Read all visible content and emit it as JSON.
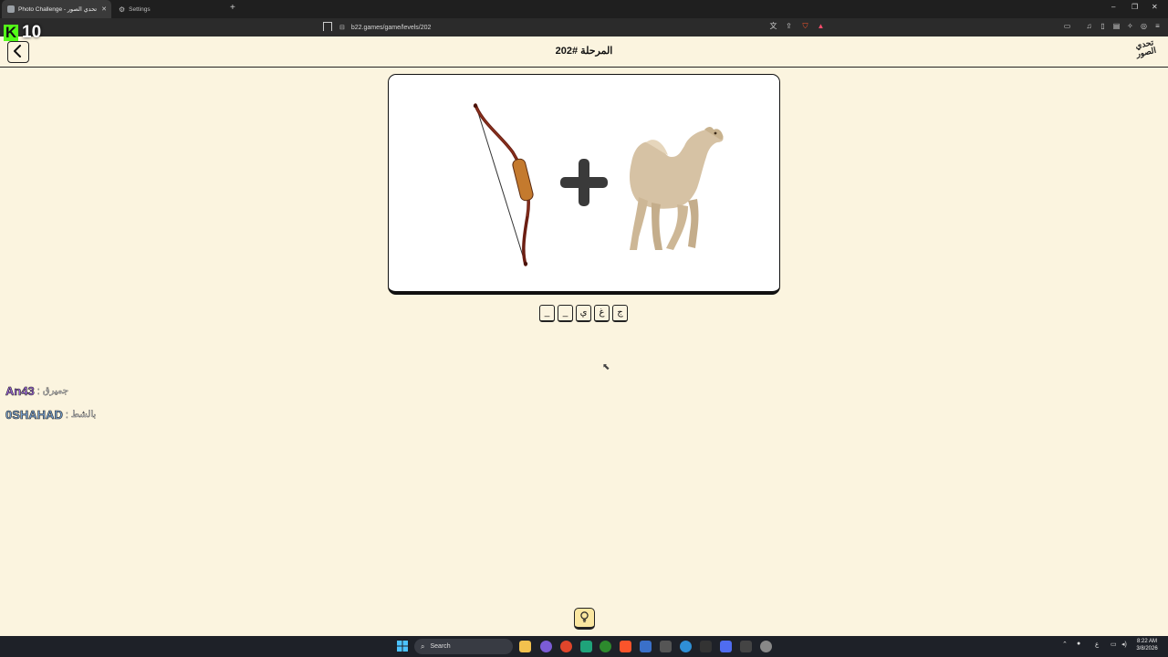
{
  "browser": {
    "tabs": [
      {
        "title": "Photo Challenge - تحدي الصور",
        "active": true
      },
      {
        "title": "Settings",
        "active": false
      }
    ],
    "url": "b22.games/game/levels/202",
    "new_tab_symbol": "+",
    "window_controls": [
      "–",
      "❐",
      "✕"
    ]
  },
  "overlay": {
    "kick_badge": "K",
    "viewer_count": "10"
  },
  "header": {
    "level_title": "المرحلة #202",
    "site_logo": "تحدي الصور"
  },
  "puzzle": {
    "images": [
      "bow-image",
      "plus-icon",
      "camel-image"
    ],
    "tiles": [
      "ج",
      "غ",
      "ي",
      "_",
      "_"
    ]
  },
  "chat": [
    {
      "user": "An43",
      "message": "جميرق",
      "color": "#a066e0"
    },
    {
      "user": "0SHAHAD",
      "message": "بالشط",
      "color": "#7aa6d6"
    }
  ],
  "taskbar": {
    "search_placeholder": "Search",
    "time": "8:22 AM",
    "date": "3/8/2026"
  },
  "colors": {
    "page_bg": "#fbf4df",
    "accent_green": "#53fc18",
    "hint_bg": "#fbe7a0"
  }
}
